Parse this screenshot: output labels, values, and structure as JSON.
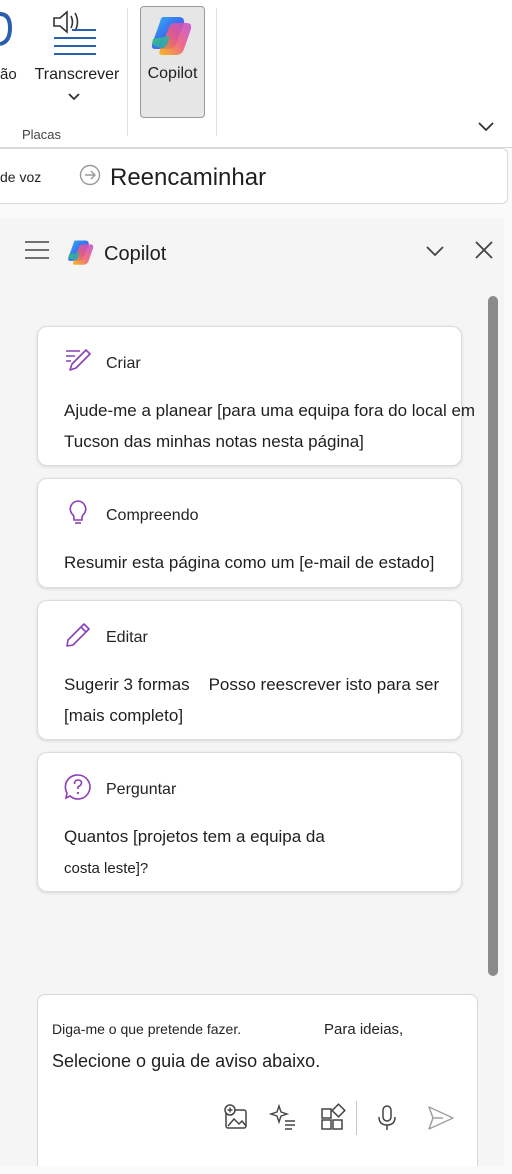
{
  "ribbon": {
    "dictate_label_partial": "ão",
    "transcribe_label": "Transcrever",
    "copilot_label": "Copilot",
    "group_label": "Placas"
  },
  "notice": {
    "left_text": "de voz",
    "main_text": "Reencaminhar"
  },
  "pane": {
    "title": "Copilot",
    "cards": [
      {
        "icon": "create-pencil-icon",
        "title": "Criar",
        "body": "Ajude-me a planear [para uma equipa fora do local em Tucson das minhas notas nesta página]"
      },
      {
        "icon": "lightbulb-icon",
        "title": "Compreendo",
        "body": "Resumir esta página como um [e-mail de estado]"
      },
      {
        "icon": "edit-pencil-icon",
        "title": "Editar",
        "body_line1": "Sugerir 3 formas",
        "body_line1b": "Posso reescrever isto para ser",
        "body_line2": "[mais completo]"
      },
      {
        "icon": "question-bubble-icon",
        "title": "Perguntar",
        "body_line1": "Quantos [projetos tem a equipa da",
        "body_line2": "costa leste]?"
      }
    ]
  },
  "input": {
    "placeholder_part1": "Diga-me o que pretende fazer.",
    "placeholder_part2": "Para ideias,",
    "placeholder_line2": "Selecione o guia de aviso abaixo."
  },
  "colors": {
    "accent_purple": "#8a3fb8",
    "copilot_selected_bg": "#e6e6e6",
    "scrollbar": "#8a8a8a"
  }
}
